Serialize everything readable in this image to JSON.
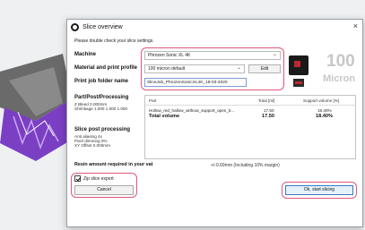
{
  "window": {
    "title": "Slice overview",
    "close_glyph": "×"
  },
  "subtitle": "Please double check your slice settings.",
  "fields": {
    "machine_label": "Machine",
    "machine_value": "Phrozen Sonic XL 4K",
    "profile_label": "Material and print profile",
    "profile_value": "100 micron default",
    "edit_label": "Edit",
    "folder_label": "Print job folder name",
    "folder_value": "SliceJob_PhrozenSonicXL4K_18-03-2020"
  },
  "layer_display": {
    "number": "100",
    "unit": "Micron"
  },
  "part_processing": {
    "title": "Part/Post/Processing",
    "lines": [
      "Z Bleed 0.000mm",
      "Shrinkage 1.000 1.000 1.000"
    ]
  },
  "slice_post": {
    "title": "Slice post processing",
    "lines": [
      "Anti aliasing 4x",
      "Pixel dimming 0%",
      "XY Offset 0.000mm"
    ]
  },
  "table": {
    "headers": [
      "Part",
      "Total [ml]",
      "Support volume [%]"
    ],
    "rows": [
      {
        "part": "Hollow_red_hallow_without_support_open_b...",
        "total": "17.50",
        "support": "18.40%"
      }
    ],
    "total_row": {
      "label": "Total volume",
      "total": "17.50",
      "support": "18.40%"
    }
  },
  "resin": {
    "label": "Resin amount required in your vat",
    "value": "+/-0.69mm (Including 10% margin)"
  },
  "zip_label": "Zip slice export",
  "buttons": {
    "cancel": "Cancel",
    "ok": "Ok, start slicing"
  },
  "colors": {
    "highlight": "#e0577a",
    "accent": "#3e79c9",
    "model_purple": "#7b3fc4"
  }
}
